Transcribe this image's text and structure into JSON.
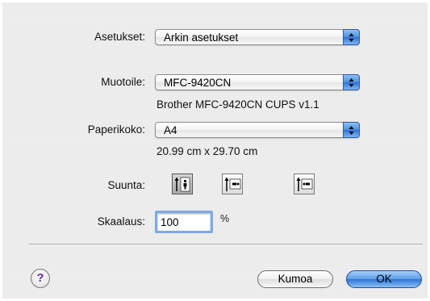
{
  "settings": {
    "label": "Asetukset:",
    "value": "Arkin asetukset"
  },
  "format_for": {
    "label": "Muotoile:",
    "value": "MFC-9420CN",
    "description": "Brother MFC-9420CN CUPS v1.1"
  },
  "paper_size": {
    "label": "Paperikoko:",
    "value": "A4",
    "dimensions": "20.99 cm x 29.70 cm"
  },
  "orientation": {
    "label": "Suunta:",
    "options": [
      {
        "icon": "portrait-orientation-icon",
        "selected": true
      },
      {
        "icon": "landscape-orientation-icon",
        "selected": false
      },
      {
        "icon": "landscape-reversed-orientation-icon",
        "selected": false
      }
    ]
  },
  "scale": {
    "label": "Skaalaus:",
    "value": "100",
    "unit": "%"
  },
  "buttons": {
    "help": "?",
    "cancel": "Kumoa",
    "ok": "OK"
  },
  "colors": {
    "accent": "#4b8fe0",
    "help_glyph": "#6a2aa6"
  }
}
